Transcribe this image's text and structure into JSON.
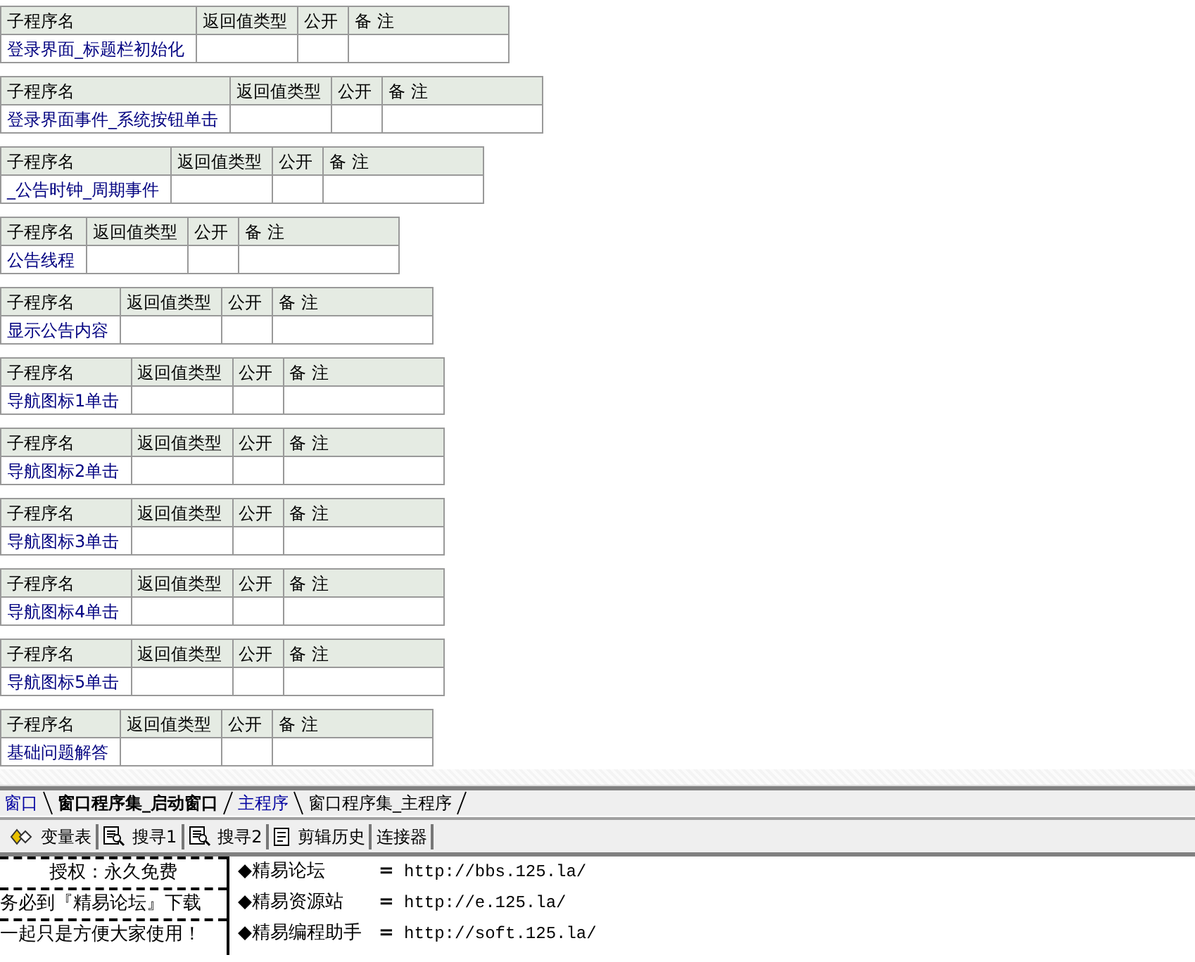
{
  "subroutines": [
    {
      "columns": [
        "子程序名",
        "返回值类型",
        "公开",
        "备 注"
      ],
      "name": "登录界面_标题栏初始化"
    },
    {
      "columns": [
        "子程序名",
        "返回值类型",
        "公开",
        "备 注"
      ],
      "name": "登录界面事件_系统按钮单击"
    },
    {
      "columns": [
        "子程序名",
        "返回值类型",
        "公开",
        "备 注"
      ],
      "name": "_公告时钟_周期事件"
    },
    {
      "columns": [
        "子程序名",
        "返回值类型",
        "公开",
        "备 注"
      ],
      "name": "公告线程"
    },
    {
      "columns": [
        "子程序名",
        "返回值类型",
        "公开",
        "备 注"
      ],
      "name": "显示公告内容"
    },
    {
      "columns": [
        "子程序名",
        "返回值类型",
        "公开",
        "备 注"
      ],
      "name": "导航图标1单击"
    },
    {
      "columns": [
        "子程序名",
        "返回值类型",
        "公开",
        "备 注"
      ],
      "name": "导航图标2单击"
    },
    {
      "columns": [
        "子程序名",
        "返回值类型",
        "公开",
        "备 注"
      ],
      "name": "导航图标3单击"
    },
    {
      "columns": [
        "子程序名",
        "返回值类型",
        "公开",
        "备 注"
      ],
      "name": "导航图标4单击"
    },
    {
      "columns": [
        "子程序名",
        "返回值类型",
        "公开",
        "备 注"
      ],
      "name": "导航图标5单击"
    },
    {
      "columns": [
        "子程序名",
        "返回值类型",
        "公开",
        "备 注"
      ],
      "name": "基础问题解答"
    }
  ],
  "tabs": [
    {
      "label": "窗口",
      "kind": "window",
      "selected": false
    },
    {
      "label": "窗口程序集_启动窗口",
      "kind": "module",
      "selected": true
    },
    {
      "label": "主程序",
      "kind": "window",
      "selected": false
    },
    {
      "label": "窗口程序集_主程序",
      "kind": "module",
      "selected": false
    }
  ],
  "toolbar": [
    {
      "label": "变量表",
      "kind": "variables"
    },
    {
      "label": "搜寻1",
      "kind": "search"
    },
    {
      "label": "搜寻2",
      "kind": "search"
    },
    {
      "label": "剪辑历史",
      "kind": "clipboard"
    },
    {
      "label": "连接器",
      "kind": "none"
    }
  ],
  "output": {
    "left_lines": [
      {
        "text": "授权：永久免费",
        "centered": true
      },
      {
        "text": "务必到『精易论坛』下载",
        "centered": false
      },
      {
        "text": "一起只是方便大家使用！",
        "centered": false
      }
    ],
    "links": [
      {
        "name": "◆精易论坛",
        "sign": "=",
        "url": "http://bbs.125.la/"
      },
      {
        "name": "◆精易资源站",
        "sign": "=",
        "url": "http://e.125.la/"
      },
      {
        "name": "◆精易编程助手",
        "sign": "=",
        "url": "http://soft.125.la/"
      }
    ]
  }
}
